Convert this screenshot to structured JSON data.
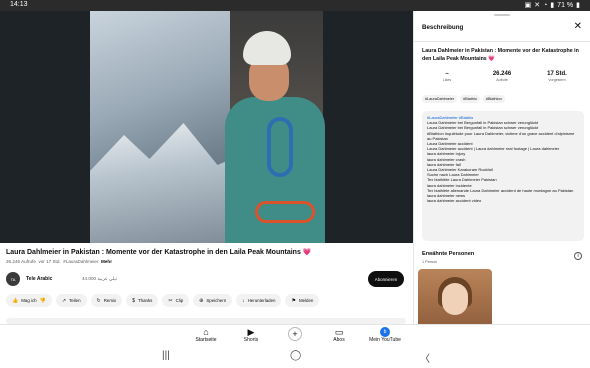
{
  "status": {
    "time": "14:13",
    "battery": "71 %"
  },
  "video": {
    "title": "Laura Dahlmeier in Pakistan : Momente vor der Katastrophe in den Laila Peak Mountains 💗",
    "meta_views": "26.246 Aufrufe",
    "meta_age": "vor 17 Std.",
    "meta_tag": "#LauraDahlmeier",
    "meta_more": "Mehr"
  },
  "channel": {
    "avatar_text": "TA",
    "name": "Tele Arabic",
    "subs": "تيلي عربية  44.000",
    "subscribe_label": "Abonnieren"
  },
  "actions": [
    {
      "icon": "👍",
      "label": "Mag ich"
    },
    {
      "icon": "👎",
      "label": ""
    },
    {
      "icon": "↗",
      "label": "Teilen"
    },
    {
      "icon": "↻",
      "label": "Remix"
    },
    {
      "icon": "$",
      "label": "Thanks"
    },
    {
      "icon": "✂",
      "label": "Clip"
    },
    {
      "icon": "⊕",
      "label": "Speichern"
    },
    {
      "icon": "↓",
      "label": "Herunterladen"
    },
    {
      "icon": "⚑",
      "label": "Melden"
    }
  ],
  "bottomnav": {
    "home": "Startseite",
    "shorts": "Shorts",
    "create": "+",
    "subs": "Abos",
    "you": "Mein YouTube",
    "you_avatar": "b"
  },
  "panel": {
    "title": "Beschreibung",
    "video_title": "Laura Dahlmeier in Pakistan : Momente vor der Katastrophe in den Laila Peak Mountains 💗",
    "stats": [
      {
        "value": "–",
        "label": "Likes"
      },
      {
        "value": "26.246",
        "label": "Aufrufe"
      },
      {
        "value": "17 Std.",
        "label": "Vorgestern"
      }
    ],
    "tags": [
      "#LauraDahlmeier",
      "#Biathlo",
      "#Biathlon"
    ],
    "description": [
      {
        "text": "#LauraDahlmeier #Biathlo",
        "link": true
      },
      {
        "text": "Laura Dahlmeier bei Bergunfall in Pakistan schwer verunglückt",
        "link": false
      },
      {
        "text": "Laura Dahlmeier bei Bergunfall in Pakistan schwer verunglückt",
        "link": false
      },
      {
        "text": "#Biathlon Inquiétude pour Laura Dahlmeier, victime d'un grave accident d'alpinisme au Pakistan",
        "link": false
      },
      {
        "text": "Laura Dahlmeier accident",
        "link": false
      },
      {
        "text": "Laura Dahlmeier accident | Laura dahlmeier real footage | Laura dahlmeier",
        "link": false
      },
      {
        "text": "laura dahlmeier injury",
        "link": false
      },
      {
        "text": "laura dahlmeier crash",
        "link": false
      },
      {
        "text": "laura dahlmeier fall",
        "link": false
      },
      {
        "text": "Laura Dahlmeier Karakoram Rockfall",
        "link": false
      },
      {
        "text": "Suche nach Laura Dahlmeier",
        "link": false
      },
      {
        "text": "Tex biathlète Laura Dahlmeier Pakistan",
        "link": false
      },
      {
        "text": "laura dahlmeier incidente",
        "link": false
      },
      {
        "text": "Tex biathlète allemande Laura Dahlmeier accident de haute montagne au Pakistan",
        "link": false
      },
      {
        "text": "laura dahlmeier news",
        "link": false
      },
      {
        "text": "laura dahlmeier accident video",
        "link": false
      }
    ],
    "people_title": "Erwähnte Personen",
    "people_count": "1 Person",
    "info": "i"
  },
  "sysnav": {
    "recents": "|||",
    "home": "◯",
    "back": "〈"
  }
}
